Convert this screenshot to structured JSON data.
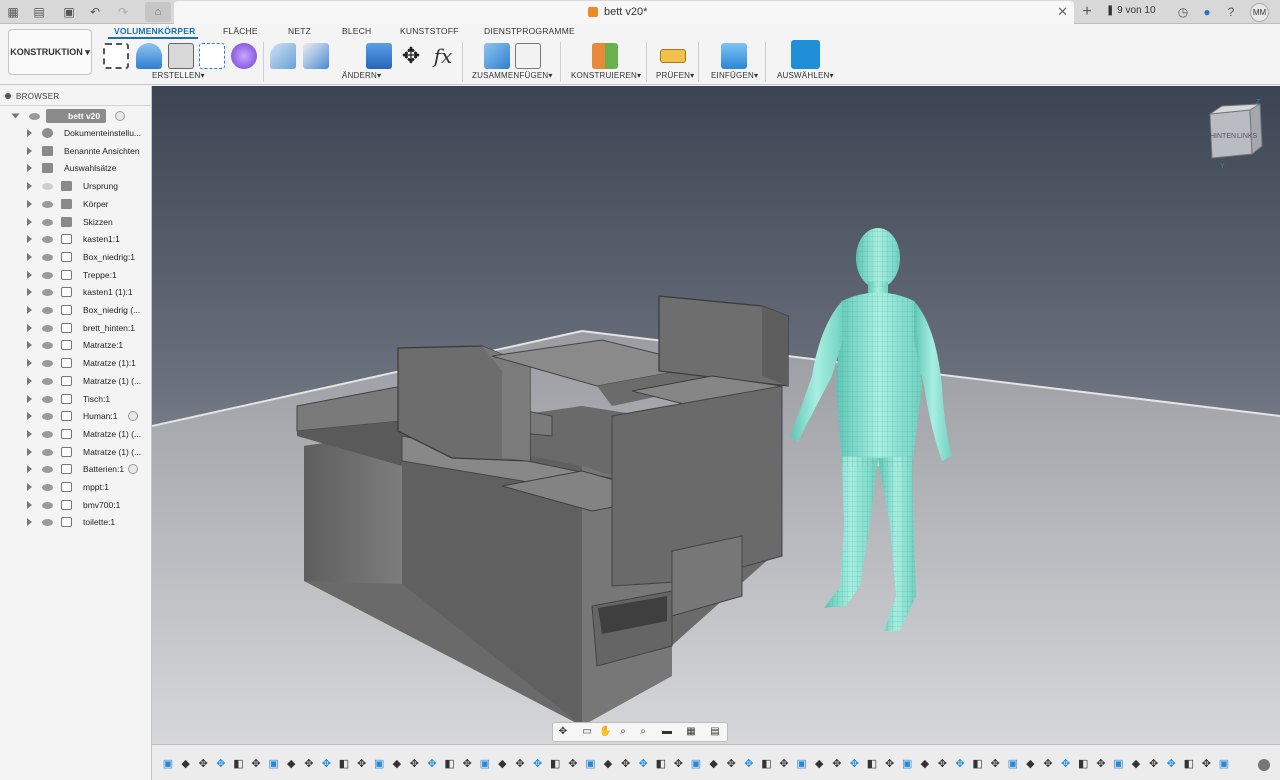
{
  "titlebar": {
    "doc_title": "bett v20*",
    "version": "9 von 10",
    "avatar_initials": "MM",
    "icons": [
      "grid-icon",
      "file-icon",
      "save-icon",
      "undo-icon",
      "redo-icon",
      "home-icon",
      "close-icon",
      "plus-icon",
      "version-icon",
      "clock-icon",
      "bell-icon",
      "help-icon"
    ]
  },
  "toolbar": {
    "workspace": "KONSTRUKTION",
    "tabs": [
      "VOLUMENKÖRPER",
      "FLÄCHE",
      "NETZ",
      "BLECH",
      "KUNSTSTOFF",
      "DIENSTPROGRAMME"
    ],
    "groups": [
      "ERSTELLEN",
      "ÄNDERN",
      "ZUSAMMENFÜGEN",
      "KONSTRUIEREN",
      "PRÜFEN",
      "EINFÜGEN",
      "AUSWÄHLEN"
    ],
    "accent": "#1a6fb8"
  },
  "browser": {
    "title": "BROWSER",
    "root": "bett v20",
    "items": [
      {
        "label": "Dokumenteinstellu...",
        "icon": "gear-icon",
        "eye": "none"
      },
      {
        "label": "Benannte Ansichten",
        "icon": "folder-icon",
        "eye": "none"
      },
      {
        "label": "Auswahlsätze",
        "icon": "folder-icon",
        "eye": "none"
      },
      {
        "label": "Ursprung",
        "icon": "folder-icon",
        "eye": "hidden"
      },
      {
        "label": "Körper",
        "icon": "folder-icon",
        "eye": "visible"
      },
      {
        "label": "Skizzen",
        "icon": "folder-icon",
        "eye": "visible"
      },
      {
        "label": "kasten1:1",
        "icon": "component-icon",
        "eye": "visible"
      },
      {
        "label": "Box_niedrig:1",
        "icon": "component-icon",
        "eye": "visible"
      },
      {
        "label": "Treppe:1",
        "icon": "component-icon",
        "eye": "visible"
      },
      {
        "label": "kasten1 (1):1",
        "icon": "component-icon",
        "eye": "visible"
      },
      {
        "label": "Box_niedrig (...",
        "icon": "component-icon",
        "eye": "visible"
      },
      {
        "label": "brett_hinten:1",
        "icon": "component-icon",
        "eye": "visible"
      },
      {
        "label": "Matratze:1",
        "icon": "component-icon",
        "eye": "visible"
      },
      {
        "label": "Matratze (1):1",
        "icon": "component-icon",
        "eye": "visible"
      },
      {
        "label": "Matratze (1) (...",
        "icon": "component-icon",
        "eye": "visible"
      },
      {
        "label": "Tisch:1",
        "icon": "component-icon",
        "eye": "visible"
      },
      {
        "label": "Human:1",
        "icon": "component-icon",
        "eye": "visible",
        "radio": true
      },
      {
        "label": "Matratze (1) (...",
        "icon": "component-icon",
        "eye": "visible"
      },
      {
        "label": "Matratze (1) (...",
        "icon": "component-icon",
        "eye": "visible"
      },
      {
        "label": "Batterien:1",
        "icon": "assembly-icon",
        "eye": "visible",
        "radio": true
      },
      {
        "label": "mppt:1",
        "icon": "component-icon",
        "eye": "visible"
      },
      {
        "label": "bmv700:1",
        "icon": "component-icon",
        "eye": "visible"
      },
      {
        "label": "toilette:1",
        "icon": "component-icon",
        "eye": "visible"
      }
    ]
  },
  "viewcube": {
    "faces": [
      "HINTEN",
      "LINKS"
    ],
    "axes": [
      "Z",
      "Y"
    ]
  },
  "navbar": {
    "icons": [
      "orbit-icon",
      "look-at-icon",
      "pan-icon",
      "zoom-icon",
      "zoom-window-icon",
      "display-settings-icon",
      "grid-icon",
      "viewports-icon"
    ]
  },
  "timeline": {
    "count": 61
  }
}
